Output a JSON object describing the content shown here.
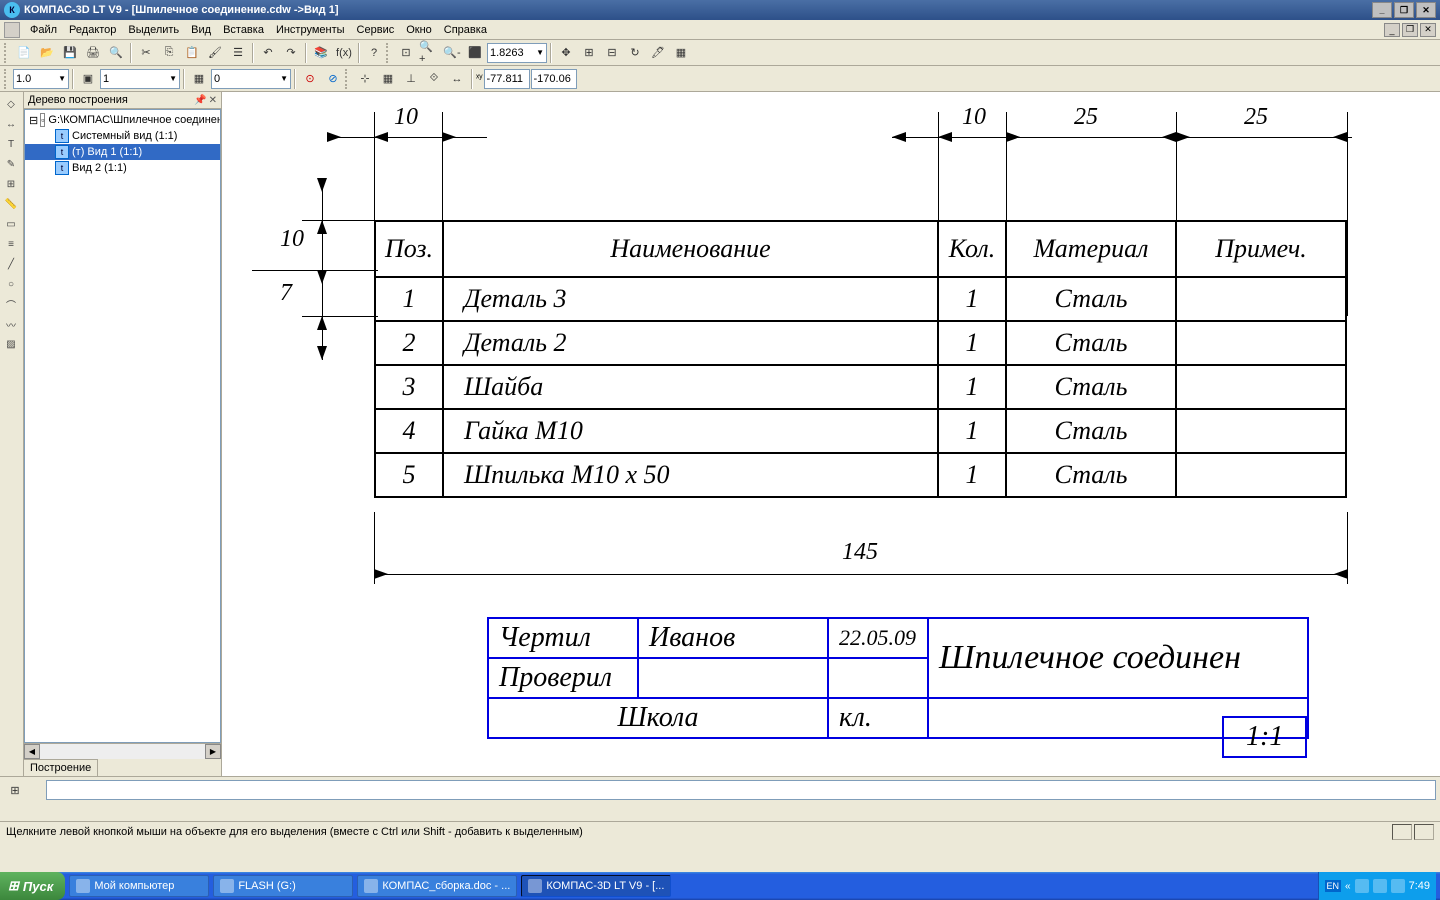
{
  "title": "КОМПАС-3D LT V9 - [Шпилечное соединение.cdw ->Вид 1]",
  "menu": [
    "Файл",
    "Редактор",
    "Выделить",
    "Вид",
    "Вставка",
    "Инструменты",
    "Сервис",
    "Окно",
    "Справка"
  ],
  "tb2": {
    "zoom": "1.8263",
    "coord_x": "-77.811",
    "coord_y": "-170.06"
  },
  "tb3": {
    "style": "1.0",
    "layer1": "1",
    "layer2": "0"
  },
  "tree": {
    "title": "Дерево построения",
    "root": "G:\\КОМПАС\\Шпилечное соединен",
    "items": [
      "Системный вид (1:1)",
      "(т) Вид 1 (1:1)",
      "Вид 2 (1:1)"
    ],
    "selected": 1,
    "tab": "Построение"
  },
  "dims": {
    "top1": "10",
    "top2": "10",
    "top3": "25",
    "top4": "25",
    "left1": "10",
    "left2": "7",
    "bottom": "145"
  },
  "bom": {
    "headers": [
      "Поз.",
      "Наименование",
      "Кол.",
      "Материал",
      "Примеч."
    ],
    "rows": [
      {
        "pos": "1",
        "name": "Деталь 3",
        "qty": "1",
        "mat": "Сталь",
        "note": ""
      },
      {
        "pos": "2",
        "name": "Деталь 2",
        "qty": "1",
        "mat": "Сталь",
        "note": ""
      },
      {
        "pos": "3",
        "name": "Шайба",
        "qty": "1",
        "mat": "Сталь",
        "note": ""
      },
      {
        "pos": "4",
        "name": "Гайка М10",
        "qty": "1",
        "mat": "Сталь",
        "note": ""
      },
      {
        "pos": "5",
        "name": "Шпилька М10 х 50",
        "qty": "1",
        "mat": "Сталь",
        "note": ""
      }
    ]
  },
  "titleblock": {
    "drew": "Чертил",
    "drew_by": "Иванов",
    "date": "22.05.09",
    "checked": "Проверил",
    "school": "Школа",
    "class": "кл.",
    "name": "Шпилечное соединен",
    "scale": "1:1"
  },
  "status": "Щелкните левой кнопкой мыши на объекте для его выделения (вместе с Ctrl или Shift - добавить к выделенным)",
  "taskbar": {
    "start": "Пуск",
    "buttons": [
      "Мой компьютер",
      "FLASH (G:)",
      "КОМПАС_сборка.doc - ...",
      "КОМПАС-3D LT V9 - [..."
    ],
    "active": 3,
    "lang": "EN",
    "arrow": "«",
    "time": "7:49"
  }
}
